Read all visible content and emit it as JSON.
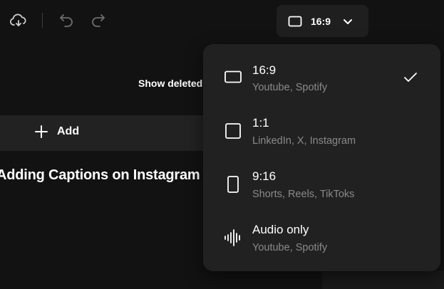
{
  "toolbar": {
    "icons": [
      "cloud-sync-icon",
      "undo-icon",
      "redo-icon"
    ]
  },
  "aspect_button": {
    "label": "16:9",
    "icon": "rectangle-icon",
    "chevron": "chevron-down-icon"
  },
  "background": {
    "show_deleted": "Show deleted",
    "add_label": "Add",
    "caption_title": "Adding Captions on Instagram"
  },
  "dropdown": {
    "options": [
      {
        "title": "16:9",
        "subtitle": "Youtube, Spotify",
        "icon": "landscape-icon",
        "selected": true
      },
      {
        "title": "1:1",
        "subtitle": "LinkedIn, X, Instagram",
        "icon": "square-icon",
        "selected": false
      },
      {
        "title": "9:16",
        "subtitle": "Shorts, Reels, TikToks",
        "icon": "portrait-icon",
        "selected": false
      },
      {
        "title": "Audio only",
        "subtitle": "Youtube, Spotify",
        "icon": "waveform-icon",
        "selected": false
      }
    ]
  },
  "colors": {
    "background": "#121212",
    "panel": "#212121",
    "subtext": "#8a8a8a",
    "icon_muted": "#6e6e6e"
  }
}
